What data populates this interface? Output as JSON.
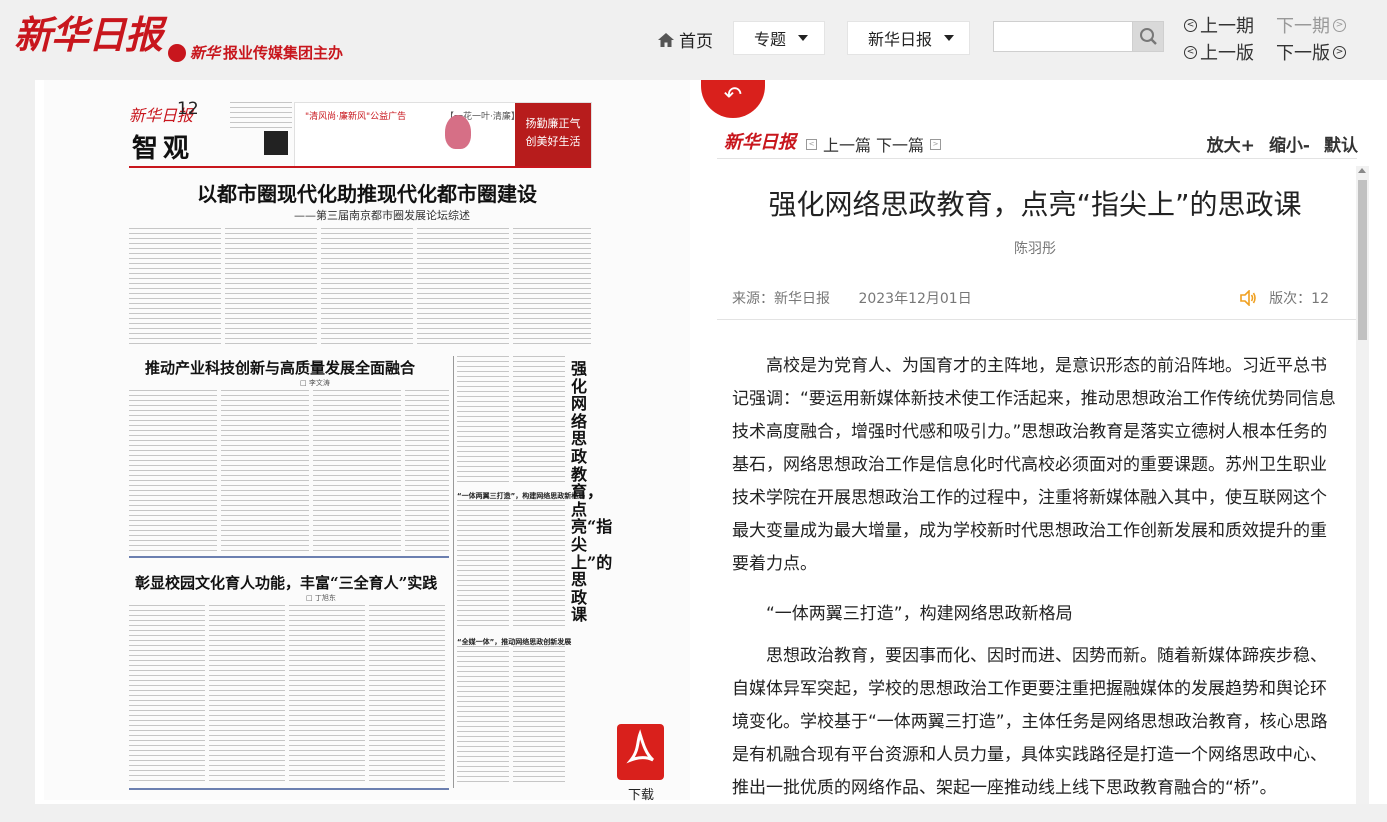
{
  "header": {
    "logo": "新华日报",
    "sub_brand": "新华",
    "sub_logo": "报业传媒集团主办",
    "home": "首页",
    "topics": "专题",
    "paper_select": "新华日报",
    "search_placeholder": "",
    "prev_issue": "上一期",
    "next_issue": "下一期",
    "prev_edition": "上一版",
    "next_edition": "下一版"
  },
  "paper": {
    "brand": "新华日报",
    "page_number": "12",
    "section": "智观",
    "ad_tagline": "\"清风尚·廉新风\"公益广告",
    "ad_brush": "【一花一叶·清廉】",
    "ad_slogan_1": "扬勤廉正气",
    "ad_slogan_2": "创美好生活",
    "headline": "以都市圈现代化助推现代化都市圈建设",
    "subheadline": "——第三届南京都市圈发展论坛综述",
    "article2_title": "推动产业科技创新与高质量发展全面融合",
    "article2_byline": "□ 李文涛",
    "article3_title": "彰显校园文化育人功能，丰富“三全育人”实践",
    "article3_byline": "□ 丁旭东",
    "vertical_title": "强化网络思政教育，点亮“指尖上”的思政课",
    "sub_heading_1": "“一体两翼三打造”，构建网络思政新格局",
    "sub_heading_2": "“全媒一体”，推动网络思政创新发展",
    "download": "下载"
  },
  "article": {
    "brand": "新华日报",
    "prev": "上一篇",
    "next": "下一篇",
    "zoom_in": "放大+",
    "zoom_out": "缩小-",
    "default": "默认",
    "title": "强化网络思政教育，点亮“指尖上”的思政课",
    "author": "陈羽彤",
    "source": "来源：新华日报",
    "date": "2023年12月01日",
    "edition": "版次：12",
    "para1": "高校是为党育人、为国育才的主阵地，是意识形态的前沿阵地。习近平总书记强调：“要运用新媒体新技术使工作活起来，推动思想政治工作传统优势同信息技术高度融合，增强时代感和吸引力。”思想政治教育是落实立德树人根本任务的基石，网络思想政治工作是信息化时代高校必须面对的重要课题。苏州卫生职业技术学院在开展思想政治工作的过程中，注重将新媒体融入其中，使互联网这个最大变量成为最大增量，成为学校新时代思想政治工作创新发展和质效提升的重要着力点。",
    "heading1": "“一体两翼三打造”，构建网络思政新格局",
    "para2": "思想政治教育，要因事而化、因时而进、因势而新。随着新媒体蹄疾步稳、自媒体异军突起，学校的思想政治工作更要注重把握融媒体的发展趋势和舆论环境变化。学校基于“一体两翼三打造”，主体任务是网络思想政治教育，核心思路是有机融合现有平台资源和人员力量，具体实践路径是打造一个网络思政中心、推出一批优质的网络作品、架起一座推动线上线下思政教育融合的“桥”。"
  },
  "colors": {
    "brand_red": "#c8161d",
    "pdf_red": "#d9201c",
    "speaker_orange": "#f0a020"
  }
}
